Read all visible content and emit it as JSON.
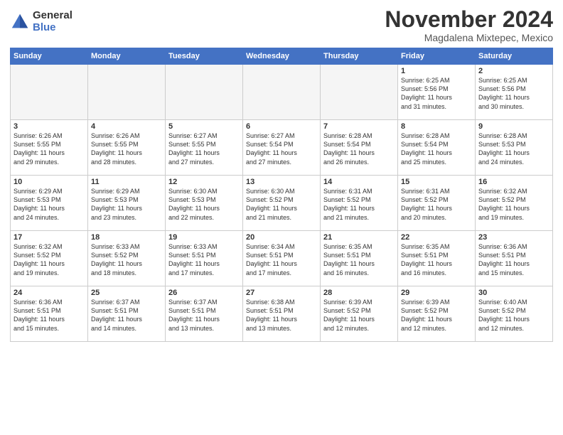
{
  "logo": {
    "general": "General",
    "blue": "Blue"
  },
  "title": "November 2024",
  "location": "Magdalena Mixtepec, Mexico",
  "weekdays": [
    "Sunday",
    "Monday",
    "Tuesday",
    "Wednesday",
    "Thursday",
    "Friday",
    "Saturday"
  ],
  "weeks": [
    [
      {
        "day": "",
        "info": ""
      },
      {
        "day": "",
        "info": ""
      },
      {
        "day": "",
        "info": ""
      },
      {
        "day": "",
        "info": ""
      },
      {
        "day": "",
        "info": ""
      },
      {
        "day": "1",
        "info": "Sunrise: 6:25 AM\nSunset: 5:56 PM\nDaylight: 11 hours\nand 31 minutes."
      },
      {
        "day": "2",
        "info": "Sunrise: 6:25 AM\nSunset: 5:56 PM\nDaylight: 11 hours\nand 30 minutes."
      }
    ],
    [
      {
        "day": "3",
        "info": "Sunrise: 6:26 AM\nSunset: 5:55 PM\nDaylight: 11 hours\nand 29 minutes."
      },
      {
        "day": "4",
        "info": "Sunrise: 6:26 AM\nSunset: 5:55 PM\nDaylight: 11 hours\nand 28 minutes."
      },
      {
        "day": "5",
        "info": "Sunrise: 6:27 AM\nSunset: 5:55 PM\nDaylight: 11 hours\nand 27 minutes."
      },
      {
        "day": "6",
        "info": "Sunrise: 6:27 AM\nSunset: 5:54 PM\nDaylight: 11 hours\nand 27 minutes."
      },
      {
        "day": "7",
        "info": "Sunrise: 6:28 AM\nSunset: 5:54 PM\nDaylight: 11 hours\nand 26 minutes."
      },
      {
        "day": "8",
        "info": "Sunrise: 6:28 AM\nSunset: 5:54 PM\nDaylight: 11 hours\nand 25 minutes."
      },
      {
        "day": "9",
        "info": "Sunrise: 6:28 AM\nSunset: 5:53 PM\nDaylight: 11 hours\nand 24 minutes."
      }
    ],
    [
      {
        "day": "10",
        "info": "Sunrise: 6:29 AM\nSunset: 5:53 PM\nDaylight: 11 hours\nand 24 minutes."
      },
      {
        "day": "11",
        "info": "Sunrise: 6:29 AM\nSunset: 5:53 PM\nDaylight: 11 hours\nand 23 minutes."
      },
      {
        "day": "12",
        "info": "Sunrise: 6:30 AM\nSunset: 5:53 PM\nDaylight: 11 hours\nand 22 minutes."
      },
      {
        "day": "13",
        "info": "Sunrise: 6:30 AM\nSunset: 5:52 PM\nDaylight: 11 hours\nand 21 minutes."
      },
      {
        "day": "14",
        "info": "Sunrise: 6:31 AM\nSunset: 5:52 PM\nDaylight: 11 hours\nand 21 minutes."
      },
      {
        "day": "15",
        "info": "Sunrise: 6:31 AM\nSunset: 5:52 PM\nDaylight: 11 hours\nand 20 minutes."
      },
      {
        "day": "16",
        "info": "Sunrise: 6:32 AM\nSunset: 5:52 PM\nDaylight: 11 hours\nand 19 minutes."
      }
    ],
    [
      {
        "day": "17",
        "info": "Sunrise: 6:32 AM\nSunset: 5:52 PM\nDaylight: 11 hours\nand 19 minutes."
      },
      {
        "day": "18",
        "info": "Sunrise: 6:33 AM\nSunset: 5:52 PM\nDaylight: 11 hours\nand 18 minutes."
      },
      {
        "day": "19",
        "info": "Sunrise: 6:33 AM\nSunset: 5:51 PM\nDaylight: 11 hours\nand 17 minutes."
      },
      {
        "day": "20",
        "info": "Sunrise: 6:34 AM\nSunset: 5:51 PM\nDaylight: 11 hours\nand 17 minutes."
      },
      {
        "day": "21",
        "info": "Sunrise: 6:35 AM\nSunset: 5:51 PM\nDaylight: 11 hours\nand 16 minutes."
      },
      {
        "day": "22",
        "info": "Sunrise: 6:35 AM\nSunset: 5:51 PM\nDaylight: 11 hours\nand 16 minutes."
      },
      {
        "day": "23",
        "info": "Sunrise: 6:36 AM\nSunset: 5:51 PM\nDaylight: 11 hours\nand 15 minutes."
      }
    ],
    [
      {
        "day": "24",
        "info": "Sunrise: 6:36 AM\nSunset: 5:51 PM\nDaylight: 11 hours\nand 15 minutes."
      },
      {
        "day": "25",
        "info": "Sunrise: 6:37 AM\nSunset: 5:51 PM\nDaylight: 11 hours\nand 14 minutes."
      },
      {
        "day": "26",
        "info": "Sunrise: 6:37 AM\nSunset: 5:51 PM\nDaylight: 11 hours\nand 13 minutes."
      },
      {
        "day": "27",
        "info": "Sunrise: 6:38 AM\nSunset: 5:51 PM\nDaylight: 11 hours\nand 13 minutes."
      },
      {
        "day": "28",
        "info": "Sunrise: 6:39 AM\nSunset: 5:52 PM\nDaylight: 11 hours\nand 12 minutes."
      },
      {
        "day": "29",
        "info": "Sunrise: 6:39 AM\nSunset: 5:52 PM\nDaylight: 11 hours\nand 12 minutes."
      },
      {
        "day": "30",
        "info": "Sunrise: 6:40 AM\nSunset: 5:52 PM\nDaylight: 11 hours\nand 12 minutes."
      }
    ]
  ]
}
